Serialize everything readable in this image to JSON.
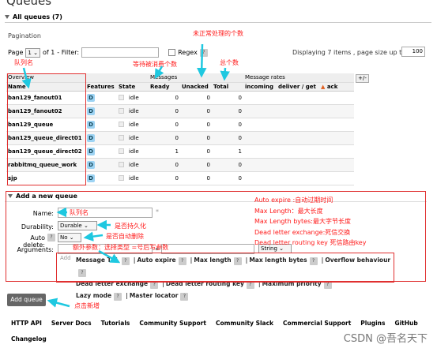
{
  "title": "Queues",
  "all_queues_header": "All queues (7)",
  "pagination": {
    "label": "Pagination",
    "page_label": "Page",
    "page_value": "1",
    "of_label": "of 1",
    "filter_label": "- Filter:",
    "regex_label": "Regex",
    "help": "?",
    "displaying_label": "Displaying 7 items , page size up to:",
    "page_size": "100"
  },
  "table": {
    "group_headers": {
      "overview": "Overview",
      "messages": "Messages",
      "message_rates": "Message rates",
      "toggle": "+/-"
    },
    "columns": {
      "name": "Name",
      "features": "Features",
      "state": "State",
      "ready": "Ready",
      "unacked": "Unacked",
      "total": "Total",
      "incoming": "incoming",
      "deliver_get": "deliver / get",
      "ack": "ack",
      "ack_arrow": "▲"
    },
    "rows": [
      {
        "name": "ban129_fanout01",
        "feature": "D",
        "state": "idle",
        "ready": "0",
        "unacked": "0",
        "total": "0"
      },
      {
        "name": "ban129_fanout02",
        "feature": "D",
        "state": "idle",
        "ready": "0",
        "unacked": "0",
        "total": "0"
      },
      {
        "name": "ban129_queue",
        "feature": "D",
        "state": "idle",
        "ready": "0",
        "unacked": "0",
        "total": "0"
      },
      {
        "name": "ban129_queue_direct01",
        "feature": "D",
        "state": "idle",
        "ready": "0",
        "unacked": "0",
        "total": "0"
      },
      {
        "name": "ban129_queue_direct02",
        "feature": "D",
        "state": "idle",
        "ready": "1",
        "unacked": "0",
        "total": "1"
      },
      {
        "name": "rabbitmq_queue_work",
        "feature": "D",
        "state": "idle",
        "ready": "0",
        "unacked": "0",
        "total": "0"
      },
      {
        "name": "sjp",
        "feature": "D",
        "state": "idle",
        "ready": "0",
        "unacked": "0",
        "total": "0"
      }
    ]
  },
  "add_queue": {
    "header": "Add a new queue",
    "name_label": "Name:",
    "name_required": "*",
    "durability_label": "Durability:",
    "durability_value": "Durable",
    "auto_delete_label": "Auto delete:",
    "auto_delete_value": "No",
    "arguments_label": "Arguments:",
    "arguments_type": "String",
    "equals": "=",
    "add_link": "Add",
    "arg_keys": [
      "Message TTL",
      "Auto expire",
      "Max length",
      "Max length bytes",
      "Overflow behaviour",
      "Dead letter exchange",
      "Dead letter routing key",
      "Maximum priority",
      "Lazy mode",
      "Master locator"
    ],
    "sep": "|",
    "button": "Add queue"
  },
  "footer": {
    "links": [
      "HTTP API",
      "Server Docs",
      "Tutorials",
      "Community Support",
      "Community Slack",
      "Commercial Support",
      "Plugins",
      "GitHub"
    ],
    "changelog": "Changelog"
  },
  "annotations": {
    "unhandled": "未正常处理的个数",
    "waiting": "等待被消费个数",
    "total": "总个数",
    "queue_name_col": "队列名",
    "queue_name_field": "队列名",
    "persist": "是否持久化",
    "auto_delete": "是否自动删除",
    "extra_args": "额外参数：选择类型     =号后写参数",
    "click_add": "点击新增",
    "right_notes": [
      "Auto expire :自动过期时间",
      "Max Length：最大长度",
      "Max Length bytes:最大字节长度",
      "Dead letter exchange:死信交换",
      "Dead letter routing key 死信路由key"
    ]
  },
  "watermark": "CSDN @吾名天下",
  "colors": {
    "annotation": "#ff1a1a",
    "arrow": "#1ec8e0",
    "badge": "#9dd3f3"
  }
}
